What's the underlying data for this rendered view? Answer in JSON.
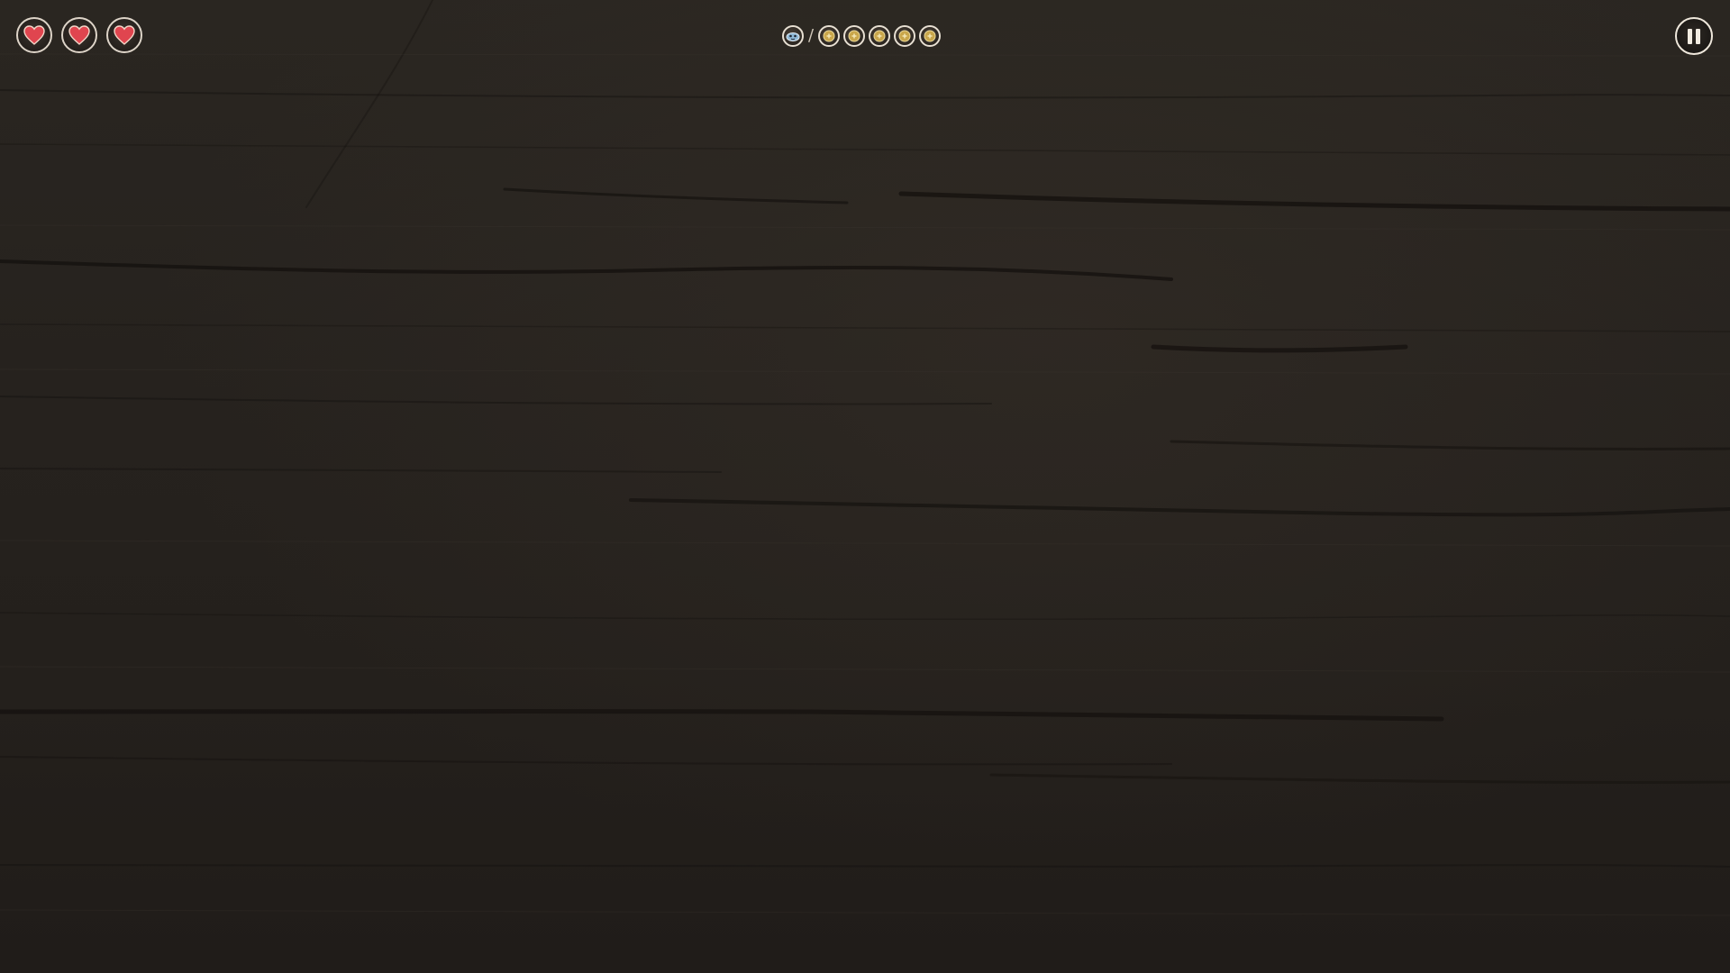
{
  "hud": {
    "hearts": [
      {
        "icon": "heart-icon",
        "state": "full"
      },
      {
        "icon": "heart-icon",
        "state": "full"
      },
      {
        "icon": "heart-icon",
        "state": "full"
      }
    ],
    "progress": {
      "current_icon": "character-face-icon",
      "separator": "/",
      "coins": [
        {
          "icon": "gold-coin-icon"
        },
        {
          "icon": "gold-coin-icon"
        },
        {
          "icon": "gold-coin-icon"
        },
        {
          "icon": "gold-coin-icon"
        },
        {
          "icon": "gold-coin-icon"
        }
      ]
    },
    "pause_icon": "pause-icon"
  },
  "colors": {
    "background": "#26221e",
    "heart": "#e0454f",
    "ring": "#ddd4c8",
    "coin_gold": "#c9a64a",
    "face_blue": "#8fb8d6"
  }
}
